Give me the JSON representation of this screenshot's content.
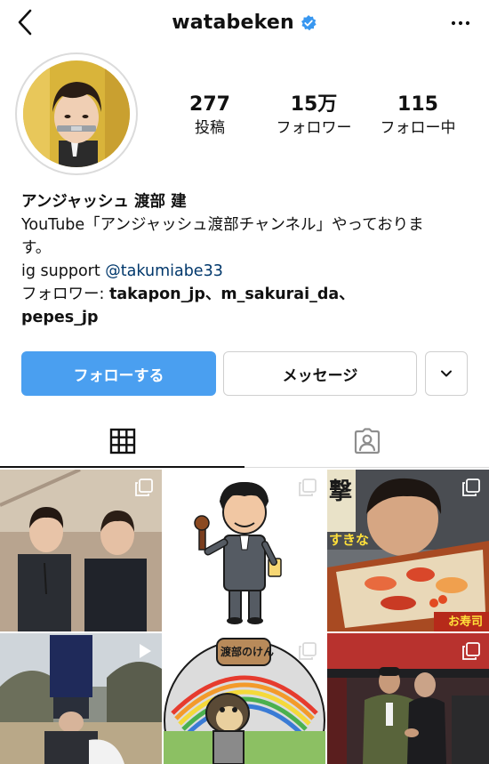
{
  "header": {
    "username": "watabeken",
    "verified": true,
    "back_icon": "chevron-left-icon",
    "more_icon": "more-horizontal-icon"
  },
  "stats": [
    {
      "value": "277",
      "label": "投稿"
    },
    {
      "value": "15万",
      "label": "フォロワー"
    },
    {
      "value": "115",
      "label": "フォロー中"
    }
  ],
  "bio": {
    "display_name": "アンジャッシュ 渡部 建",
    "line1": "YouTube「アンジャッシュ渡部チャンネル」やっておりま",
    "line2": "す。",
    "support_prefix": "ig support ",
    "support_mention": "@takumiabe33",
    "followed_prefix": "フォロワー: ",
    "followed_by_1": "takapon_jp、m_sakurai_da、",
    "followed_by_2": "pepes_jp"
  },
  "actions": {
    "follow_label": "フォローする",
    "message_label": "メッセージ",
    "more_icon": "chevron-down-icon"
  },
  "tabs": {
    "grid_icon": "grid-icon",
    "tagged_icon": "tagged-person-icon"
  },
  "colors": {
    "follow_button": "#4a9ff0",
    "verified_badge": "#3897f0",
    "mention": "#00376b"
  },
  "posts": [
    {
      "name": "two-men-photo",
      "multi": true
    },
    {
      "name": "cartoon-man-illustration",
      "multi": true
    },
    {
      "name": "bento-closeup-photo",
      "multi": true,
      "overlay_text_1": "撃",
      "overlay_text_2": "すきな",
      "overlay_text_3": "お寿司"
    },
    {
      "name": "costume-person-photo",
      "video": true
    },
    {
      "name": "watabe-logo-illustration",
      "multi": true,
      "overlay_text": "渡部のけん"
    },
    {
      "name": "stadium-men-photo",
      "multi": true
    }
  ]
}
